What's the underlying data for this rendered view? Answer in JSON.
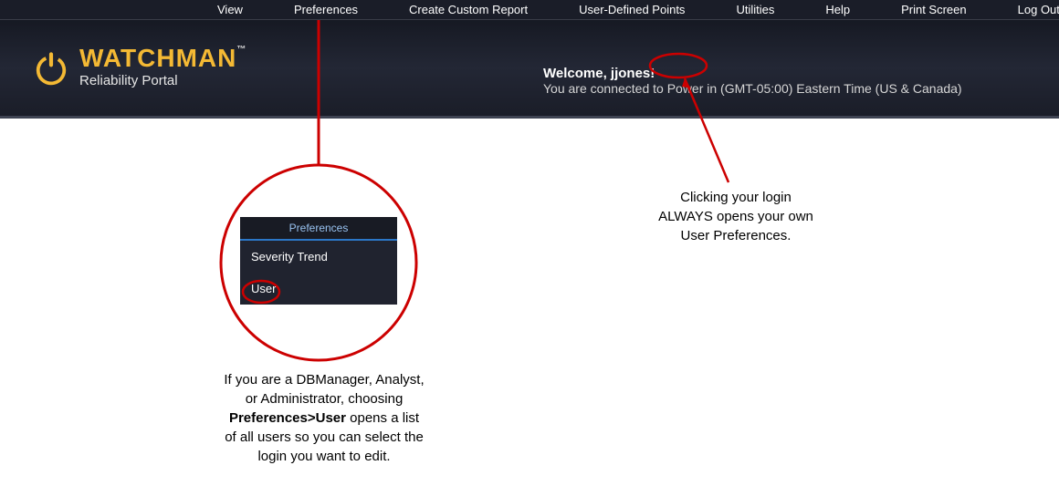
{
  "menu": {
    "view": "View",
    "preferences": "Preferences",
    "create_custom_report": "Create Custom Report",
    "user_defined_points": "User-Defined Points",
    "utilities": "Utilities",
    "help": "Help",
    "print_screen": "Print Screen",
    "log_out": "Log Out"
  },
  "logo": {
    "brand": "WATCHMAN",
    "tm": "™",
    "tagline": "Reliability Portal"
  },
  "welcome": {
    "prefix": "Welcome, ",
    "username": "jjones!",
    "connection": "You are connected to Power in (GMT-05:00) Eastern Time (US & Canada)"
  },
  "dropdown": {
    "title": "Preferences",
    "item1": "Severity Trend",
    "item2": "User"
  },
  "callout_left": {
    "l1": "If you are a DBManager, Analyst,",
    "l2": "or Administrator, choosing",
    "l3_bold": "Preferences>User",
    "l3_rest": " opens a list",
    "l4": "of all users so you can select the",
    "l5": "login you want to edit."
  },
  "callout_right": {
    "l1": "Clicking your login",
    "l2": "ALWAYS opens your own",
    "l3": "User Preferences."
  }
}
